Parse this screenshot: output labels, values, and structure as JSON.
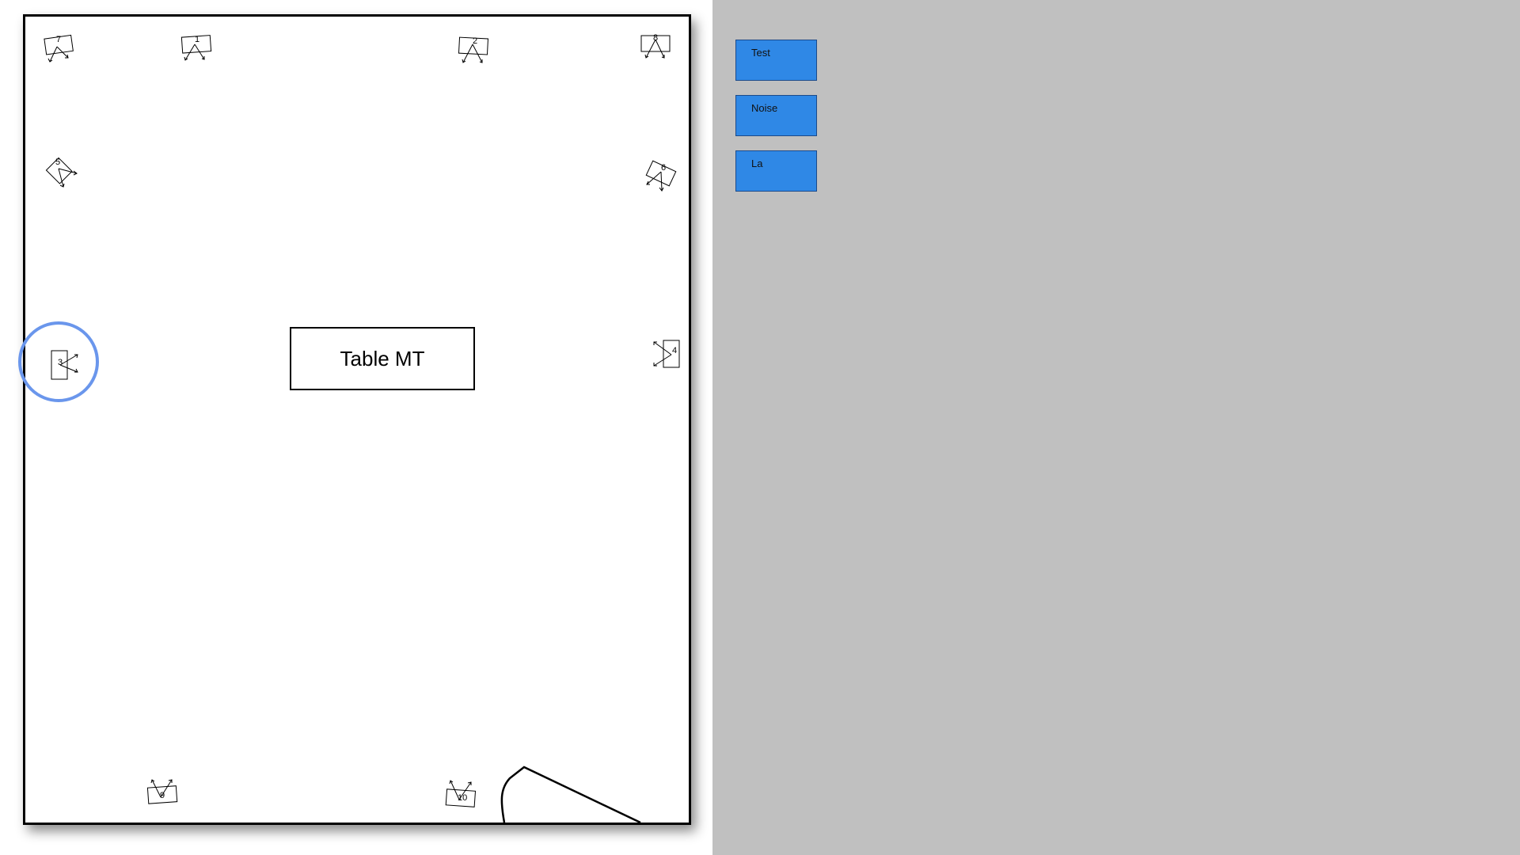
{
  "room": {
    "table_label": "Table MT",
    "speakers": [
      {
        "id": "7",
        "label": "7"
      },
      {
        "id": "1",
        "label": "1"
      },
      {
        "id": "2",
        "label": "2"
      },
      {
        "id": "8",
        "label": "8"
      },
      {
        "id": "5",
        "label": "5"
      },
      {
        "id": "6",
        "label": "6"
      },
      {
        "id": "3",
        "label": "3"
      },
      {
        "id": "4",
        "label": "4"
      },
      {
        "id": "9",
        "label": "9"
      },
      {
        "id": "10",
        "label": "10"
      }
    ],
    "selected_speaker": "3"
  },
  "sidebar": {
    "buttons": [
      {
        "label": "Test"
      },
      {
        "label": "Noise"
      },
      {
        "label": "La"
      }
    ]
  },
  "colors": {
    "sidebar_bg": "#c0c0c0",
    "button_fill": "#2f88e6",
    "selection_ring": "#6a96ec"
  }
}
